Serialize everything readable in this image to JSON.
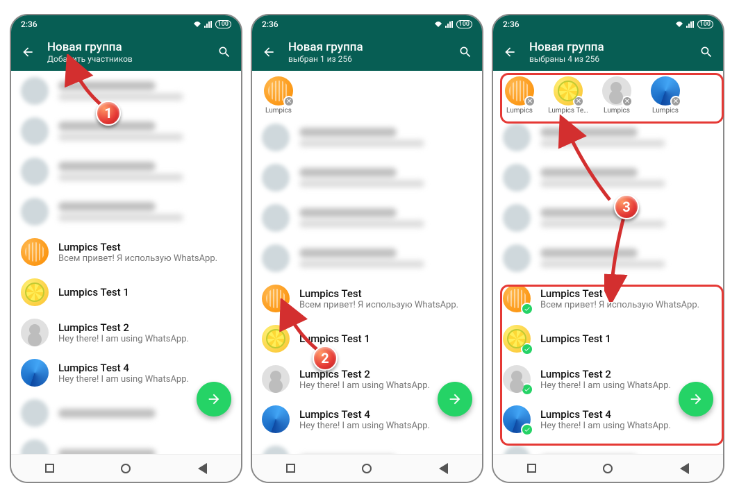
{
  "status": {
    "time": "2:36",
    "battery": "100"
  },
  "screens": [
    {
      "title": "Новая группа",
      "subtitle": "Добавить участников",
      "contacts": [
        {
          "name": "Lumpics Test",
          "status": "Всем привет! Я использую WhatsApp.",
          "avatar": "orange",
          "checked": false
        },
        {
          "name": "Lumpics Test 1",
          "status": "",
          "avatar": "lemon",
          "checked": false
        },
        {
          "name": "Lumpics Test 2",
          "status": "Hey there! I am using WhatsApp.",
          "avatar": "blank",
          "checked": false
        },
        {
          "name": "Lumpics Test 4",
          "status": "Hey there! I am using WhatsApp.",
          "avatar": "blue",
          "checked": false
        }
      ]
    },
    {
      "title": "Новая группа",
      "subtitle": "выбран 1 из 256",
      "chips": [
        {
          "label": "Lumpics",
          "avatar": "orange"
        }
      ],
      "contacts": [
        {
          "name": "Lumpics Test",
          "status": "Всем привет! Я использую WhatsApp.",
          "avatar": "orange",
          "checked": true
        },
        {
          "name": "Lumpics Test 1",
          "status": "",
          "avatar": "lemon",
          "checked": false
        },
        {
          "name": "Lumpics Test 2",
          "status": "Hey there! I am using WhatsApp.",
          "avatar": "blank",
          "checked": false
        },
        {
          "name": "Lumpics Test 4",
          "status": "Hey there! I am using WhatsApp.",
          "avatar": "blue",
          "checked": false
        }
      ]
    },
    {
      "title": "Новая группа",
      "subtitle": "выбраны 4 из 256",
      "chips": [
        {
          "label": "Lumpics",
          "avatar": "orange"
        },
        {
          "label": "Lumpics Te…",
          "avatar": "lemon"
        },
        {
          "label": "Lumpics",
          "avatar": "blank"
        },
        {
          "label": "Lumpics",
          "avatar": "blue"
        }
      ],
      "contacts": [
        {
          "name": "Lumpics Test",
          "status": "Всем привет! Я использую WhatsApp.",
          "avatar": "orange",
          "checked": true
        },
        {
          "name": "Lumpics Test 1",
          "status": "",
          "avatar": "lemon",
          "checked": true
        },
        {
          "name": "Lumpics Test 2",
          "status": "Hey there! I am using WhatsApp.",
          "avatar": "blank",
          "checked": true
        },
        {
          "name": "Lumpics Test 4",
          "status": "Hey there! I am using WhatsApp.",
          "avatar": "blue",
          "checked": true
        }
      ]
    }
  ],
  "markers": {
    "1": "1",
    "2": "2",
    "3": "3"
  }
}
